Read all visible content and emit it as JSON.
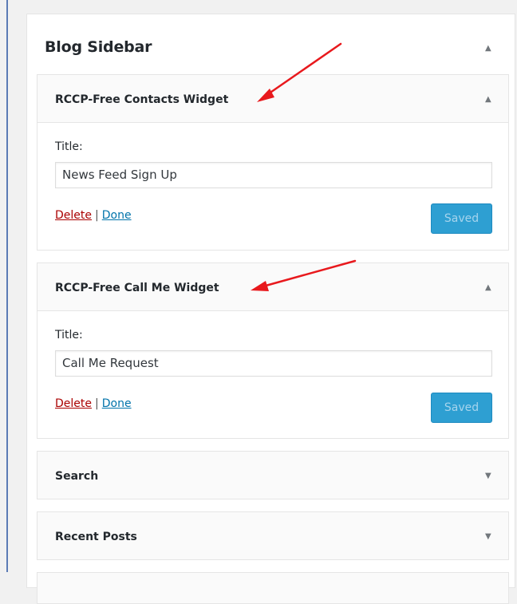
{
  "sidebar": {
    "title": "Blog Sidebar",
    "toggle_icon": "triangle-up-icon"
  },
  "widgets": [
    {
      "title": "RCCP-Free Contacts Widget",
      "expanded": true,
      "field_label": "Title:",
      "field_value": "News Feed Sign Up",
      "delete_label": "Delete",
      "separator": "|",
      "done_label": "Done",
      "saved_label": "Saved"
    },
    {
      "title": "RCCP-Free Call Me Widget",
      "expanded": true,
      "field_label": "Title:",
      "field_value": "Call Me Request",
      "delete_label": "Delete",
      "separator": "|",
      "done_label": "Done",
      "saved_label": "Saved"
    },
    {
      "title": "Search",
      "expanded": false
    },
    {
      "title": "Recent Posts",
      "expanded": false
    }
  ],
  "colors": {
    "annotation_arrow": "#e8191d",
    "saved_button": "#2e9fd2",
    "delete_link": "#aa0000",
    "done_link": "#0073aa"
  }
}
